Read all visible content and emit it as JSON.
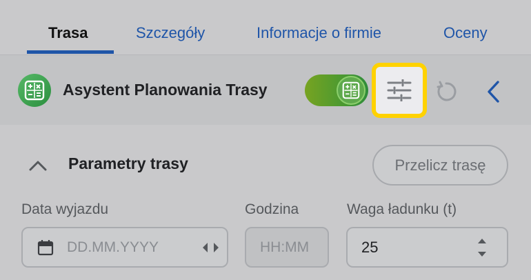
{
  "tabs": [
    {
      "label": "Trasa"
    },
    {
      "label": "Szczegóły"
    },
    {
      "label": "Informacje o firmie"
    },
    {
      "label": "Oceny"
    }
  ],
  "assistant": {
    "title": "Asystent Planowania Trasy",
    "toggle_on": true
  },
  "route_params": {
    "title": "Parametry trasy",
    "recalc_button": "Przelicz trasę",
    "date_label": "Data wyjazdu",
    "date_placeholder": "DD.MM.YYYY",
    "time_label": "Godzina",
    "time_placeholder": "HH:MM",
    "weight_label": "Waga ładunku (t)",
    "weight_value": "25"
  },
  "colors": {
    "accent": "#1f55a8",
    "highlight": "#ffd200",
    "toggle_green": "#4e9a30"
  }
}
